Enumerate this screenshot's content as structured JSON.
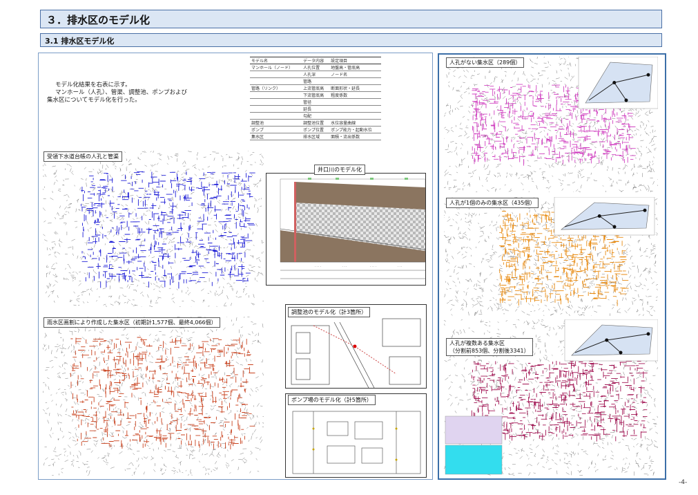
{
  "header": {
    "section_title": "３．排水区のモデル化",
    "subsection_title": "3.1  排水区モデル化"
  },
  "description": {
    "lines": [
      "モデル化結果を右表に示す。",
      "マンホール（人孔）、管渠、調整池、ポンプおよび",
      "集水区についてモデル化を行った。"
    ]
  },
  "legend_table": {
    "headers": [
      "モデル名",
      "データ内容",
      "設定項目"
    ],
    "rows": [
      [
        "マンホール（ノード）",
        "人孔位置",
        "地盤高・管底高"
      ],
      [
        "",
        "人孔深",
        "ノード名"
      ],
      [
        "",
        "管路",
        ""
      ],
      [
        "管路（リンク）",
        "上流管底高",
        "断面形状・延長"
      ],
      [
        "",
        "下流管底高",
        "粗度係数"
      ],
      [
        "",
        "管径",
        ""
      ],
      [
        "",
        "延長",
        ""
      ],
      [
        "",
        "勾配",
        ""
      ],
      [
        "調整池",
        "調整池位置",
        "水位容量曲線"
      ],
      [
        "ポンプ",
        "ポンプ位置",
        "ポンプ能力・起動水位"
      ],
      [
        "集水区",
        "排水区域",
        "面積・流出係数"
      ]
    ]
  },
  "labels": {
    "manhole_map": "受領下水道台帳の人孔と管渠",
    "inoguchi": "井口川のモデル化",
    "catchment_map": "雨水区画割により作成した集水区（初期計1,577個、最終4,066個）",
    "pond": "調整池のモデル化（計3箇所）",
    "pump": "ポンプ場のモデル化（計5箇所）",
    "no_manhole": "人孔がない集水区（289個）",
    "one_manhole": "人孔が1個のみの集水区（435個）",
    "multi_manhole_1": "人孔が複数ある集水区",
    "multi_manhole_2": "（分割前853個、分割後3341）"
  },
  "colors": {
    "header_bg": "#dbe6f4",
    "header_border": "#4a6fa5",
    "pipe_blue": "#1a1ad6",
    "catchment_red": "#c8401c",
    "magenta": "#d040c0",
    "orange": "#e88a10",
    "yellow": "#f0d000",
    "cyan": "#33ddee",
    "river_brown": "#8b7560"
  },
  "page_number": "-4-"
}
